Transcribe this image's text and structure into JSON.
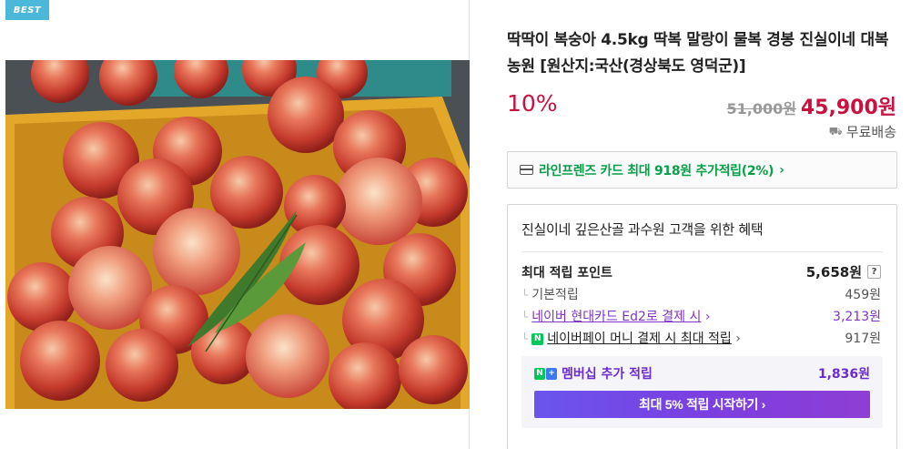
{
  "badge": {
    "label": "BEST"
  },
  "product": {
    "title": "딱딱이 복숭아 4.5kg 딱복 말랑이 물복 경봉 진실이네 대복농원 [원산지:국산(경상북도 영덕군)]",
    "discount_rate": "10%",
    "original_price": "51,000원",
    "sale_price": "45,900원",
    "shipping_icon": "truck-icon",
    "shipping": "무료배송",
    "image_description_icon": "product-photo-peaches"
  },
  "card_promo": {
    "icon": "credit-card-icon",
    "text": "라인프렌즈 카드 최대 918원 추가적립(2%)",
    "arrow": "›"
  },
  "benefits": {
    "title": "진실이네 깊은산골 과수원 고객을 위한 혜택",
    "max_points_label": "최대 적립 포인트",
    "max_points_value": "5,658원",
    "help": "?",
    "rows": [
      {
        "label": "기본적립",
        "value": "459원"
      },
      {
        "label": "네이버 현대카드 Ed2로 결제 시",
        "arrow": "›",
        "value": "3,213원"
      },
      {
        "label": "네이버페이 머니 결제 시 최대 적립",
        "arrow": "›",
        "value": "917원",
        "icon": "N"
      }
    ],
    "membership": {
      "label": "멤버십 추가 적립",
      "value": "1,836원",
      "icon_n": "N",
      "icon_plus": "+",
      "button": "최대 5% 적립 시작하기 ›"
    }
  },
  "colors": {
    "accent_red": "#c8113f",
    "promo_green": "#07a048",
    "membership_purple": "#6b2bd0",
    "badge_blue": "#4cb8d9"
  }
}
